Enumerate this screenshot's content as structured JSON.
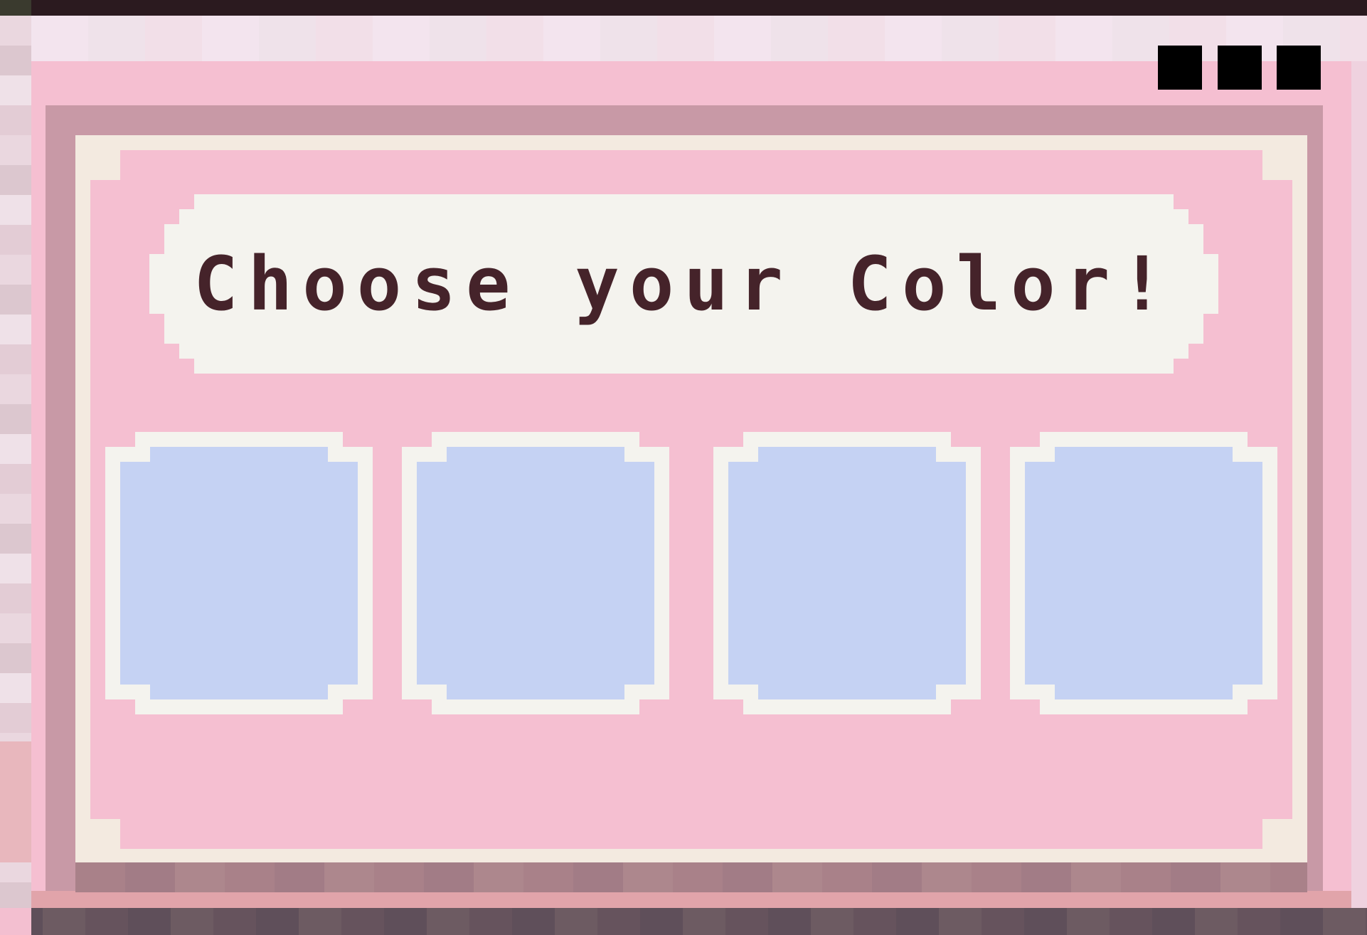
{
  "dialog": {
    "title": "Choose your Color!"
  },
  "window_controls": [
    "square-button",
    "square-button",
    "square-button"
  ],
  "color_slots": [
    {
      "color": "#c5d2f3"
    },
    {
      "color": "#c5d2f3"
    },
    {
      "color": "#c5d2f3"
    },
    {
      "color": "#c5d2f3"
    }
  ],
  "colors": {
    "window_pink": "#f5bfd1",
    "banner": "#f4f3ee",
    "title_text": "#45232a",
    "slot_fill": "#c5d2f3"
  }
}
